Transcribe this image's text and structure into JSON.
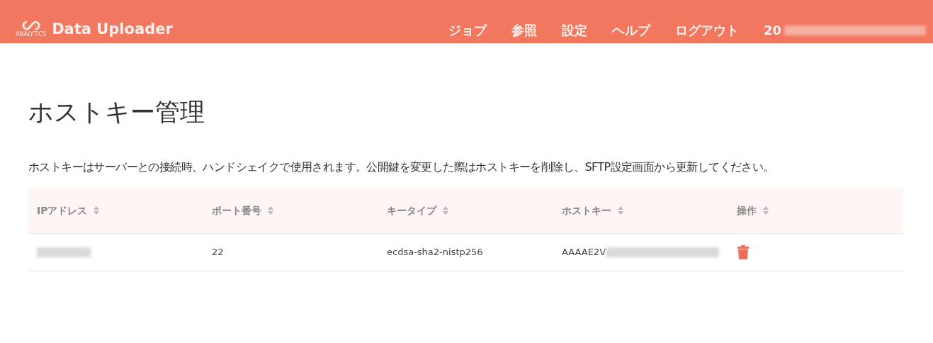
{
  "header": {
    "logo_caption": "ANALYTICS",
    "app_name": "Data Uploader",
    "nav": [
      "ジョブ",
      "参照",
      "設定",
      "ヘルプ",
      "ログアウト"
    ],
    "user": "20"
  },
  "page": {
    "title": "ホストキー管理",
    "description": "ホストキーはサーバーとの接続時、ハンドシェイクで使用されます。公開鍵を変更した際はホストキーを削除し、SFTP設定画面から更新してください。"
  },
  "table": {
    "columns": [
      "IPアドレス",
      "ポート番号",
      "キータイプ",
      "ホストキー",
      "操作"
    ],
    "rows": [
      {
        "port": "22",
        "key_type": "ecdsa-sha2-nistp256",
        "host_key": "AAAAE2V"
      }
    ]
  }
}
